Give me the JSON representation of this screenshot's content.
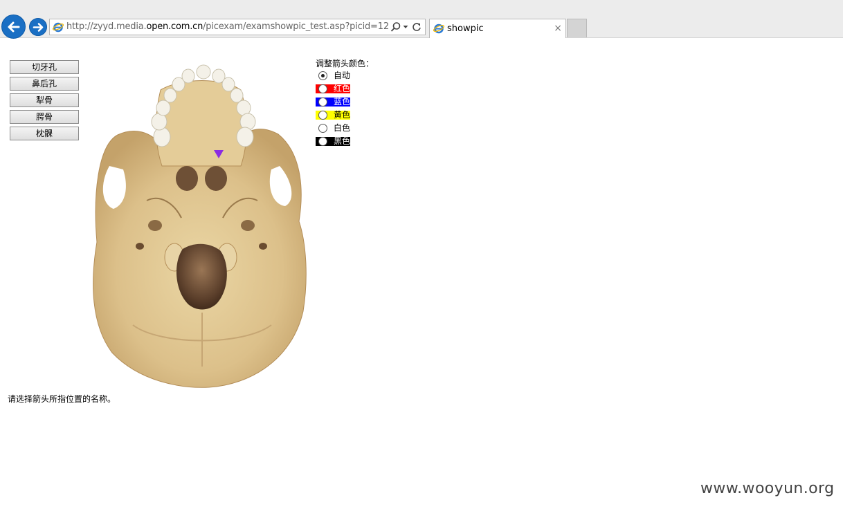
{
  "browser": {
    "url_prefix": "http://zyyd.media.",
    "url_host": "open.com.cn",
    "url_path": "/picexam/examshowpic_test.asp?picid=12",
    "tab_title": "showpic",
    "tab_close": "×"
  },
  "options": [
    {
      "label": "切牙孔"
    },
    {
      "label": "鼻后孔"
    },
    {
      "label": "犁骨"
    },
    {
      "label": "腭骨"
    },
    {
      "label": "枕髁"
    }
  ],
  "color_panel": {
    "title": "调整箭头颜色：",
    "choices": [
      {
        "label": "自动",
        "swatch": "",
        "text_color": "#000000",
        "checked": true
      },
      {
        "label": "红色",
        "swatch": "#ff0000",
        "text_color": "#ffffff",
        "checked": false
      },
      {
        "label": "蓝色",
        "swatch": "#0000ff",
        "text_color": "#ffffff",
        "checked": false
      },
      {
        "label": "黄色",
        "swatch": "#ffff00",
        "text_color": "#000000",
        "checked": false
      },
      {
        "label": "白色",
        "swatch": "",
        "text_color": "#000000",
        "checked": false
      },
      {
        "label": "黑色",
        "swatch": "#000000",
        "text_color": "#ffffff",
        "checked": false
      }
    ]
  },
  "arrow_color": "#8b2be2",
  "prompt": "请选择箭头所指位置的名称。",
  "watermark": "www.wooyun.org"
}
